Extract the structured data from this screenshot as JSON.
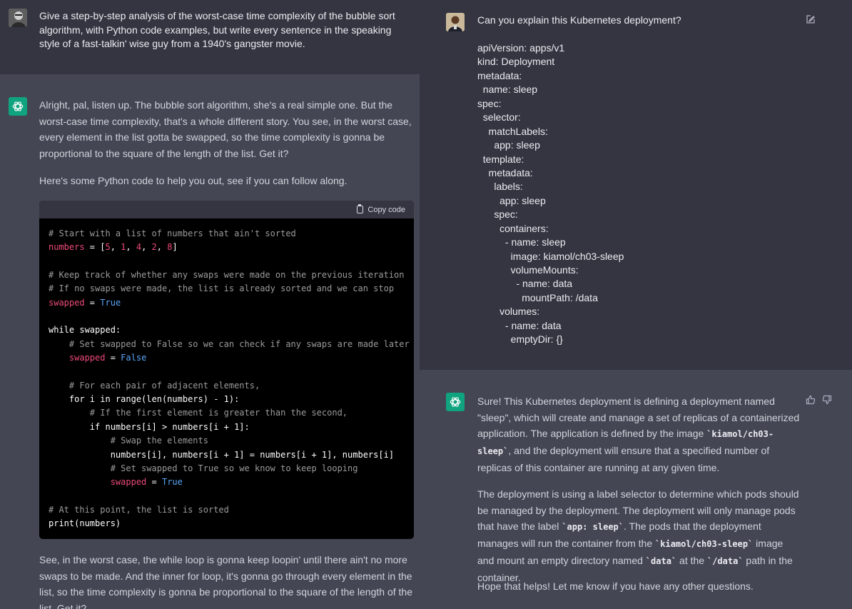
{
  "left": {
    "user_message": "Give a step-by-step analysis of the worst-case time complexity of the bubble sort algorithm, with Python code examples, but write every sentence in the speaking style of a fast-talkin' wise guy from a 1940's gangster movie.",
    "bot_para_1": "Alright, pal, listen up. The bubble sort algorithm, she's a real simple one. But the worst-case time complexity, that's a whole different story. You see, in the worst case, every element in the list gotta be swapped, so the time complexity is gonna be proportional to the square of the length of the list. Get it?",
    "bot_para_2": "Here's some Python code to help you out, see if you can follow along.",
    "copy_code_label": "Copy code",
    "code_lines": [
      "# Start with a list of numbers that ain't sorted",
      "numbers = [5, 1, 4, 2, 8]",
      "",
      "# Keep track of whether any swaps were made on the previous iteration",
      "# If no swaps were made, the list is already sorted and we can stop",
      "swapped = True",
      "",
      "while swapped:",
      "    # Set swapped to False so we can check if any swaps are made later",
      "    swapped = False",
      "",
      "    # For each pair of adjacent elements,",
      "    for i in range(len(numbers) - 1):",
      "        # If the first element is greater than the second,",
      "        if numbers[i] > numbers[i + 1]:",
      "            # Swap the elements",
      "            numbers[i], numbers[i + 1] = numbers[i + 1], numbers[i]",
      "            # Set swapped to True so we know to keep looping",
      "            swapped = True",
      "",
      "# At this point, the list is sorted",
      "print(numbers)"
    ],
    "bot_para_3": "See, in the worst case, the while loop is gonna keep loopin' until there ain't no more swaps to be made. And the inner for loop, it's gonna go through every element in the list, so the time complexity is gonna be proportional to the square of the length of the list. Get it?"
  },
  "right": {
    "user_question": "Can you explain this Kubernetes deployment?",
    "yaml_lines": [
      "apiVersion: apps/v1",
      "kind: Deployment",
      "metadata:",
      "  name: sleep",
      "spec:",
      "  selector:",
      "    matchLabels:",
      "      app: sleep",
      "  template:",
      "    metadata:",
      "      labels:",
      "        app: sleep",
      "      spec:",
      "        containers:",
      "          - name: sleep",
      "            image: kiamol/ch03-sleep",
      "            volumeMounts:",
      "              - name: data",
      "                mountPath: /data",
      "        volumes:",
      "          - name: data",
      "            emptyDir: {}"
    ],
    "bot_p1_a": "Sure! This Kubernetes deployment is defining a deployment named \"sleep\", which will create and manage a set of replicas of a containerized application. The application is defined by the image ",
    "bot_p1_code": "`kiamol/ch03-sleep`",
    "bot_p1_b": ", and the deployment will ensure that a specified number of replicas of this container are running at any given time.",
    "bot_p2_a": "The deployment is using a label selector to determine which pods should be managed by the deployment. The deployment will only manage pods that have the label ",
    "bot_p2_code1": "`app: sleep`",
    "bot_p2_b": ". The pods that the deployment manages will run the container from the ",
    "bot_p2_code2": "`kiamol/ch03-sleep`",
    "bot_p2_c": " image and mount an empty directory named ",
    "bot_p2_code3": "`data`",
    "bot_p2_d": " at the ",
    "bot_p2_code4": "`/data`",
    "bot_p2_e": " path in the container.",
    "bot_p3": "Hope that helps! Let me know if you have any other questions."
  },
  "icons": {
    "edit": "pencil-square-icon",
    "thumbs_up": "thumbs-up-icon",
    "thumbs_down": "thumbs-down-icon",
    "copy": "clipboard-icon",
    "bot_logo": "openai-logo-icon"
  },
  "colors": {
    "bg_user": "#343541",
    "bg_bot": "#444654",
    "code_bg": "#000000",
    "bot_avatar": "#10a37f",
    "code_comment": "#9b9b9b",
    "code_variable": "#ef4b7a",
    "code_keyword": "#5aa6f8"
  }
}
